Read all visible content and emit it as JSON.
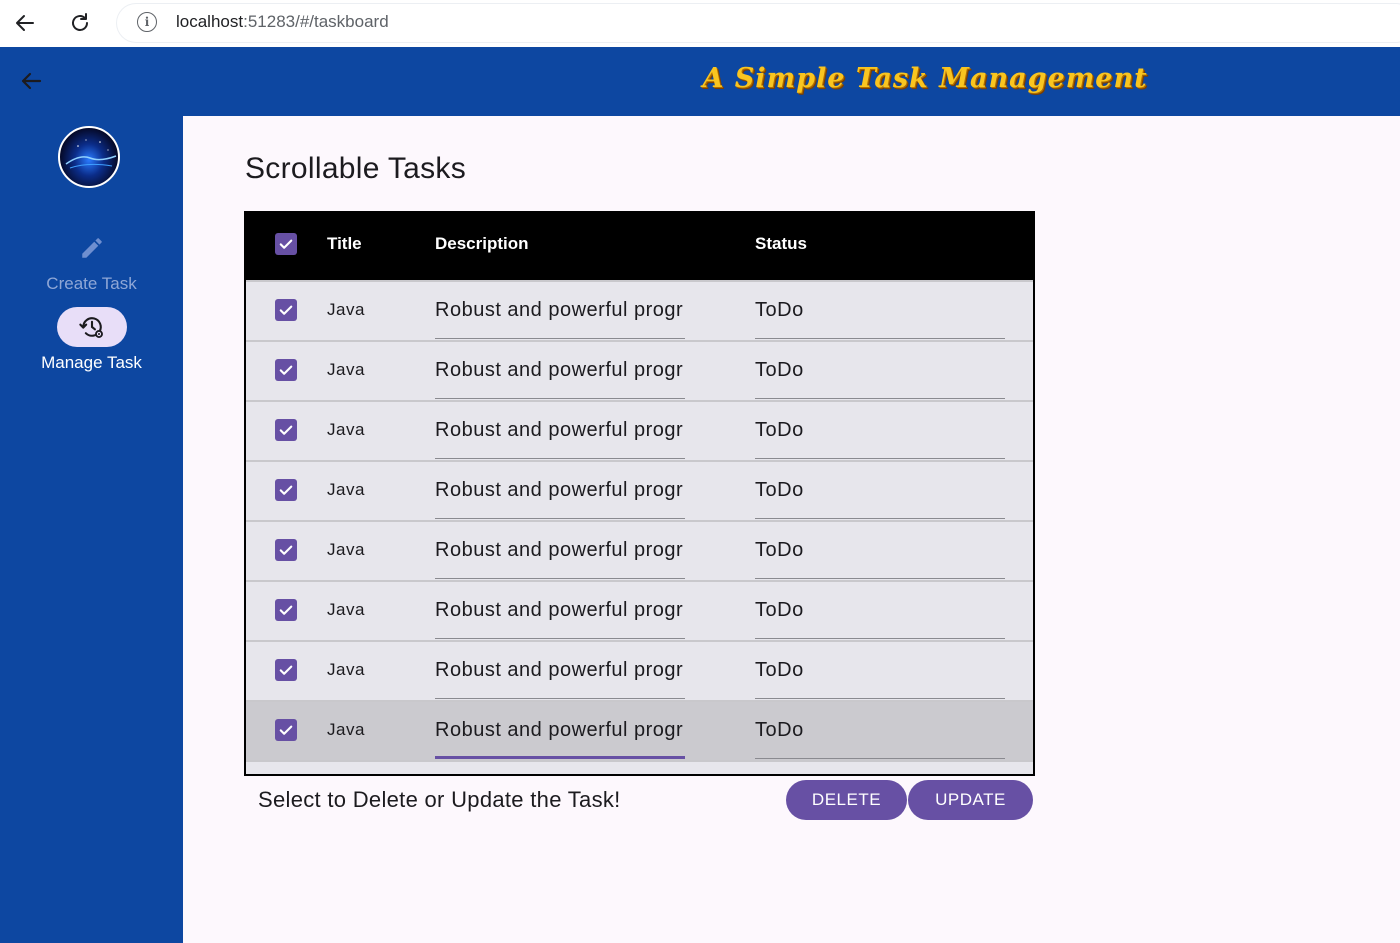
{
  "browser": {
    "url_host": "localhost",
    "url_rest": ":51283/#/taskboard"
  },
  "app_bar": {
    "title": "A Simple Task Management"
  },
  "sidebar": {
    "items": [
      {
        "label": "Create Task",
        "icon": "pencil-icon",
        "selected": false
      },
      {
        "label": "Manage Task",
        "icon": "manage-history-icon",
        "selected": true
      }
    ]
  },
  "main": {
    "title": "Scrollable Tasks",
    "table": {
      "columns": [
        "Title",
        "Description",
        "Status"
      ],
      "rows": [
        {
          "checked": true,
          "title": "Java",
          "description": "Robust and powerful progr",
          "status": "ToDo"
        },
        {
          "checked": true,
          "title": "Java",
          "description": "Robust and powerful progr",
          "status": "ToDo"
        },
        {
          "checked": true,
          "title": "Java",
          "description": "Robust and powerful progr",
          "status": "ToDo"
        },
        {
          "checked": true,
          "title": "Java",
          "description": "Robust and powerful progr",
          "status": "ToDo"
        },
        {
          "checked": true,
          "title": "Java",
          "description": "Robust and powerful progr",
          "status": "ToDo"
        },
        {
          "checked": true,
          "title": "Java",
          "description": "Robust and powerful progr",
          "status": "ToDo"
        },
        {
          "checked": true,
          "title": "Java",
          "description": "Robust and powerful progr",
          "status": "ToDo"
        },
        {
          "checked": true,
          "title": "Java",
          "description": "Robust and powerful progr",
          "status": "ToDo"
        }
      ]
    },
    "footer_text": "Select to Delete or Update the Task!",
    "delete_label": "DELETE",
    "update_label": "UPDATE"
  },
  "colors": {
    "app_bar": "#0d47a1",
    "accent": "#6750a4",
    "title_gold": "#f9c520"
  }
}
